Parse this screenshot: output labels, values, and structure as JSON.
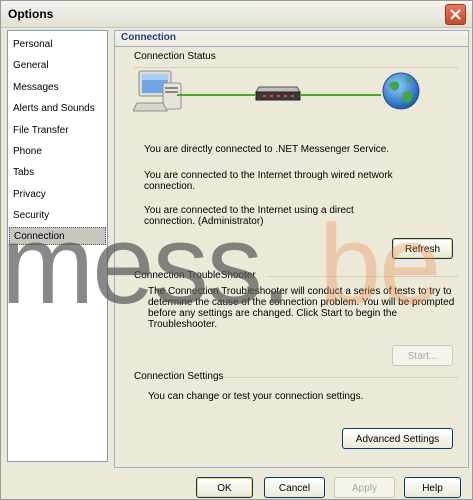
{
  "window": {
    "title": "Options"
  },
  "sidebar": {
    "items": [
      {
        "label": "Personal"
      },
      {
        "label": "General"
      },
      {
        "label": "Messages"
      },
      {
        "label": "Alerts and Sounds"
      },
      {
        "label": "File Transfer"
      },
      {
        "label": "Phone"
      },
      {
        "label": "Tabs"
      },
      {
        "label": "Privacy"
      },
      {
        "label": "Security"
      },
      {
        "label": "Connection"
      }
    ],
    "selected": "Connection"
  },
  "panel": {
    "title": "Connection",
    "status": {
      "heading": "Connection Status",
      "lines": [
        "You are directly connected to .NET Messenger Service.",
        "You are connected to the Internet through wired network connection.",
        "You are connected to the Internet using a direct connection. (Administrator)"
      ],
      "refresh_label": "Refresh"
    },
    "troubleshooter": {
      "heading": "Connection TroubleShooter",
      "description": "The Connection Troubleshooter will conduct a series of tests to try to determine the cause of the connection problem. You will be prompted before any settings are changed. Click Start to begin the Troubleshooter.",
      "start_label": "Start..."
    },
    "settings": {
      "heading": "Connection Settings",
      "description": "You can change or test your connection settings.",
      "advanced_label": "Advanced Settings"
    }
  },
  "footer": {
    "ok": "OK",
    "cancel": "Cancel",
    "apply": "Apply",
    "help": "Help"
  },
  "watermark": {
    "part1": "mess.",
    "part2": "be"
  },
  "colors": {
    "accent_title": "#1c3f8c",
    "link_line": "#3fae1e",
    "selection": "#c8c6bd"
  },
  "icons": [
    "computer-icon",
    "router-icon",
    "globe-icon",
    "close-icon"
  ]
}
